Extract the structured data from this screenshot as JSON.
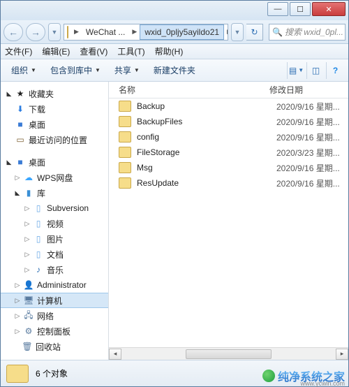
{
  "titlebar": {
    "min": "—",
    "max": "☐",
    "close": "✕"
  },
  "nav": {
    "back": "←",
    "fwd": "→",
    "crumb1": "WeChat ...",
    "crumb2": "wxid_0pljy5ayildo21",
    "search_placeholder": "搜索 wxid_0pl..."
  },
  "menu": {
    "file": "文件(F)",
    "edit": "编辑(E)",
    "view": "查看(V)",
    "tools": "工具(T)",
    "help": "帮助(H)"
  },
  "toolbar": {
    "organize": "组织",
    "include": "包含到库中",
    "share": "共享",
    "newfolder": "新建文件夹"
  },
  "columns": {
    "name": "名称",
    "date": "修改日期"
  },
  "tree": {
    "favorites": "收藏夹",
    "downloads": "下载",
    "desktop": "桌面",
    "recent": "最近访问的位置",
    "desktop2": "桌面",
    "wps": "WPS网盘",
    "libraries": "库",
    "subversion": "Subversion",
    "videos": "视频",
    "pictures": "图片",
    "documents": "文档",
    "music": "音乐",
    "admin": "Administrator",
    "computer": "计算机",
    "network": "网络",
    "control": "控制面板",
    "recycle": "回收站"
  },
  "files": [
    {
      "name": "Backup",
      "date": "2020/9/16 星期..."
    },
    {
      "name": "BackupFiles",
      "date": "2020/9/16 星期..."
    },
    {
      "name": "config",
      "date": "2020/9/16 星期..."
    },
    {
      "name": "FileStorage",
      "date": "2020/3/23 星期..."
    },
    {
      "name": "Msg",
      "date": "2020/9/16 星期..."
    },
    {
      "name": "ResUpdate",
      "date": "2020/9/16 星期..."
    }
  ],
  "status": {
    "count": "6 个对象"
  },
  "watermark": {
    "text": "纯净系统之家",
    "url": "www.ycwin.com"
  }
}
